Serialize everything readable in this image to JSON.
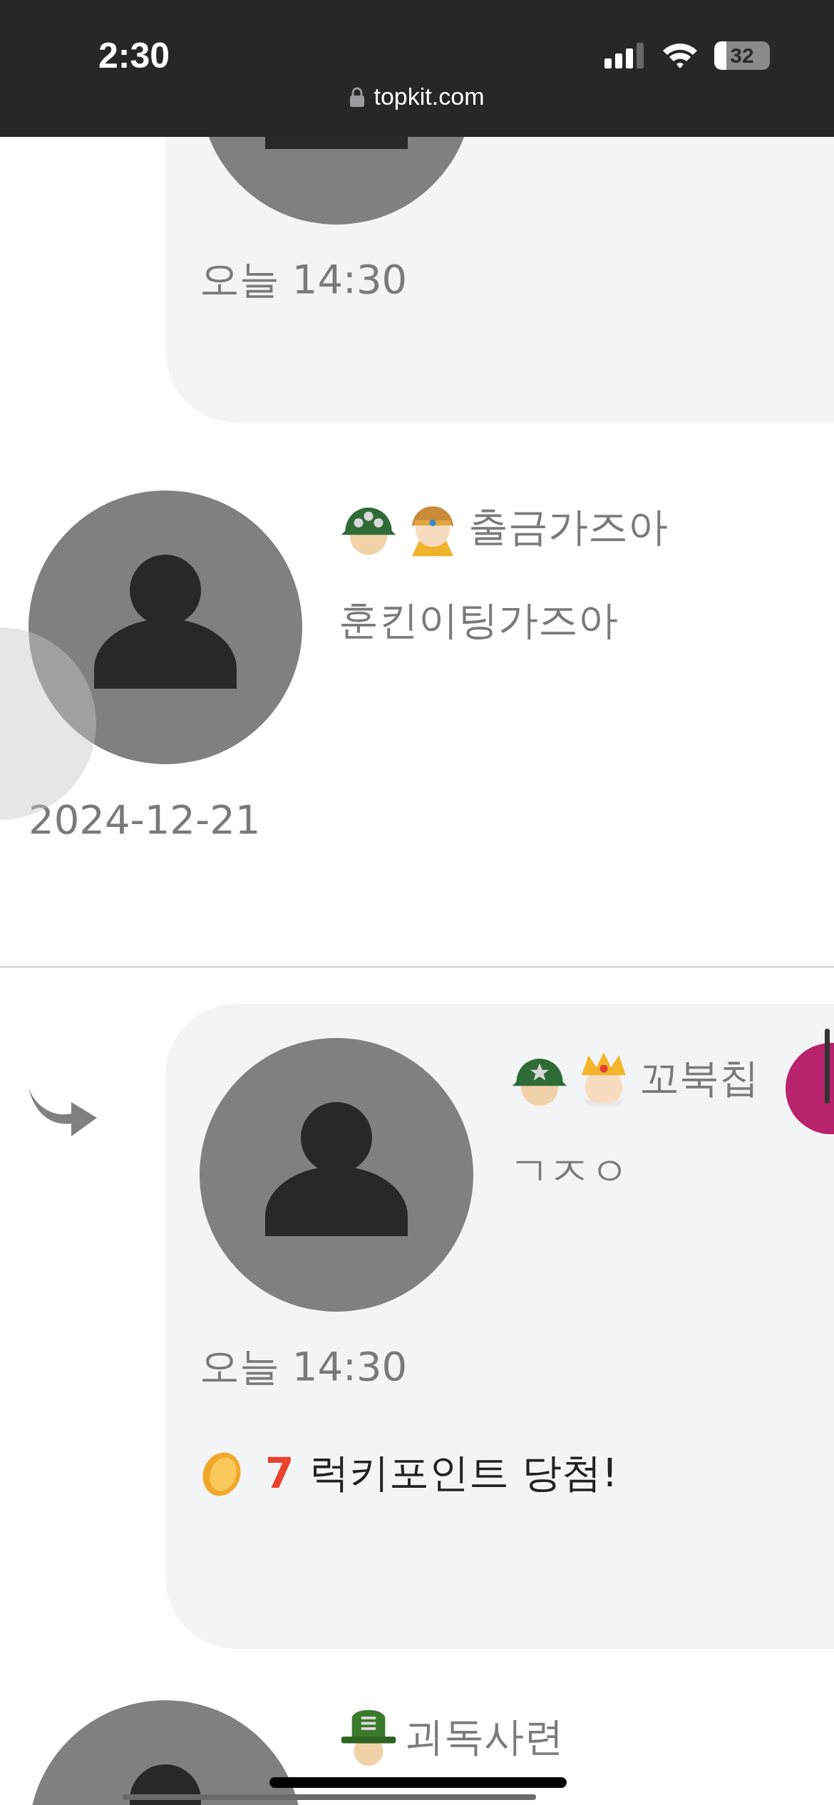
{
  "status_bar": {
    "time": "2:30",
    "battery": "32",
    "url": "topkit.com"
  },
  "comments": [
    {
      "kind": "card",
      "reply": false,
      "time": "오늘 14:30"
    },
    {
      "kind": "plain",
      "badges": [
        {
          "kind": "helmet3"
        },
        {
          "kind": "hood"
        }
      ],
      "name": "출금가즈아",
      "text": "훈킨이팅가즈아",
      "time": "2024-12-21"
    },
    {
      "kind": "card",
      "reply": true,
      "badges": [
        {
          "kind": "helmet1"
        },
        {
          "kind": "crown"
        }
      ],
      "name": "꼬북칩",
      "text": "ㄱㅈㅇ",
      "time": "오늘 14:30",
      "lucky": {
        "points": "7",
        "label": "럭키포인트 당첨!"
      }
    },
    {
      "kind": "plain",
      "badges": [
        {
          "kind": "camo"
        }
      ],
      "name": "괴독사련"
    }
  ]
}
